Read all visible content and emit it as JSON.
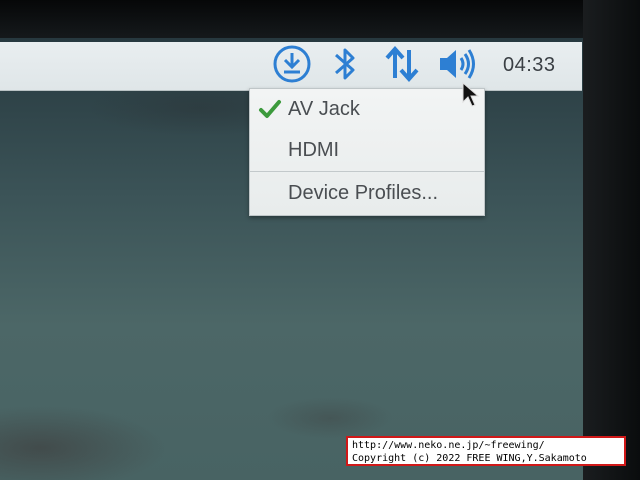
{
  "taskbar": {
    "tray_icons": [
      "download-icon",
      "bluetooth-icon",
      "network-icon",
      "volume-icon"
    ],
    "clock": "04:33"
  },
  "audio_menu": {
    "items": [
      {
        "label": "AV Jack",
        "checked": true
      },
      {
        "label": "HDMI",
        "checked": false
      },
      {
        "label": "Device Profiles...",
        "checked": false
      }
    ]
  },
  "watermark": {
    "line1": "http://www.neko.ne.jp/~freewing/",
    "line2": "Copyright (c) 2022 FREE WING,Y.Sakamoto"
  },
  "colors": {
    "icon_blue": "#2d7fd3",
    "check_green": "#3c9a3c",
    "taskbar_bg": "#e5ebed",
    "watermark_border": "#d01818"
  }
}
